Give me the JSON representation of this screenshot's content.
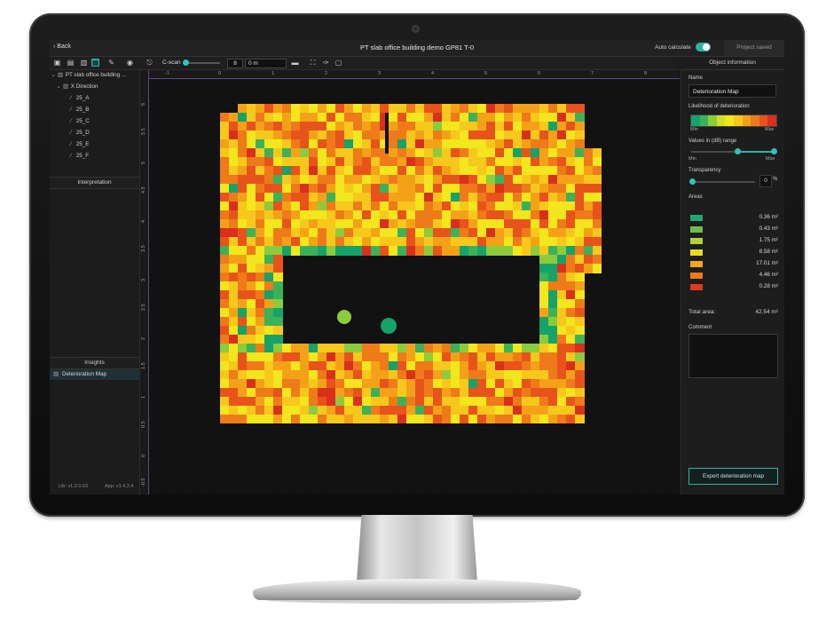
{
  "titlebar": {
    "back_label": "Back",
    "title": "PT slab office building demo GP81 T-0",
    "auto_calculate_label": "Auto calculate",
    "auto_calculate_on": true,
    "project_status": "Project saved"
  },
  "toolbar": {
    "mode_label": "C-scan",
    "depth_value": "8",
    "offset_value": "0 m"
  },
  "left_panel": {
    "project_name": "PT slab office building ...",
    "direction_label": "X Direction",
    "lines": [
      "25_A",
      "25_B",
      "25_C",
      "25_D",
      "25_E",
      "25_F"
    ],
    "interpretation_label": "Interpretation",
    "insights_label": "Insights",
    "insight_item": "Deterioration Map",
    "lib_version": "Lib: v1.2.0.63",
    "app_version": "App: v1.4.3.4"
  },
  "canvas": {
    "x_ticks": [
      "-1",
      "0",
      "1",
      "2",
      "3",
      "4",
      "5",
      "6",
      "7",
      "8"
    ],
    "y_ticks": [
      "6",
      "5.5",
      "5",
      "4.5",
      "4",
      "3.5",
      "3",
      "2.5",
      "2",
      "1.5",
      "1",
      "0.5",
      "0",
      "-0.5"
    ]
  },
  "right_panel": {
    "header": "Object information",
    "name_label": "Name",
    "name_value": "Deterioration Map",
    "likelihood_label": "Likelihood of deterioration",
    "min_label": "Min",
    "max_label": "Max",
    "range_label": "Values in (dB) range",
    "transparency_label": "Transparency",
    "transparency_value": "0",
    "transparency_unit": "%",
    "range_low_fraction": 0.55,
    "range_high_fraction": 1.0,
    "areas_label": "Areas",
    "areas": [
      {
        "color": "#1ea86f",
        "value": "0.36 m²"
      },
      {
        "color": "#6cc04a",
        "value": "0.43 m²"
      },
      {
        "color": "#b4d232",
        "value": "1.75 m²"
      },
      {
        "color": "#e8dc1e",
        "value": "8.58 m²"
      },
      {
        "color": "#f3a818",
        "value": "17.01 m²"
      },
      {
        "color": "#ee7a1a",
        "value": "4.46 m²"
      },
      {
        "color": "#e03a1c",
        "value": "0.28 m²"
      }
    ],
    "total_area_label": "Total area:",
    "total_area_value": "42.54 m²",
    "comment_label": "Comment",
    "export_label": "Export deterioration map"
  },
  "colors": {
    "accent": "#2fb3a3",
    "gradient": [
      "#15a36a",
      "#3bb25a",
      "#8ccb3c",
      "#cfe02a",
      "#f2e61c",
      "#f7c81c",
      "#f3a218",
      "#ee7a1a",
      "#e8531c",
      "#d9301e"
    ]
  }
}
